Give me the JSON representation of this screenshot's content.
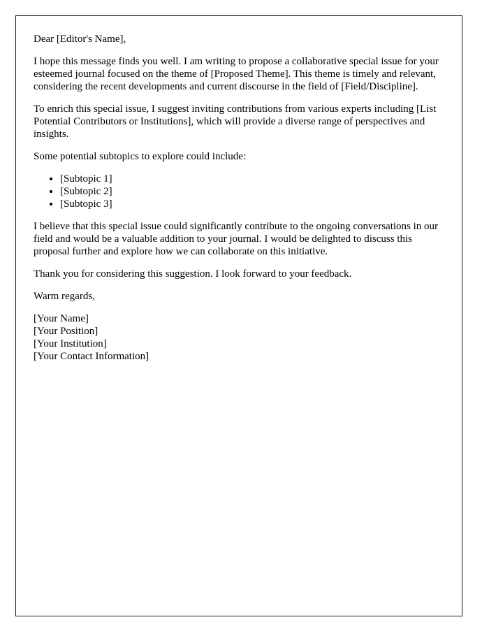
{
  "document": {
    "type": "letter",
    "salutation": "Dear [Editor's Name],",
    "paragraphs": {
      "intro": "I hope this message finds you well. I am writing to propose a collaborative special issue for your esteemed journal focused on the theme of [Proposed Theme]. This theme is timely and relevant, considering the recent developments and current discourse in the field of [Field/Discipline].",
      "contributors": "To enrich this special issue, I suggest inviting contributions from various experts including [List Potential Contributors or Institutions], which will provide a diverse range of perspectives and insights.",
      "list_intro": "Some potential subtopics to explore could include:",
      "belief": "I believe that this special issue could significantly contribute to the ongoing conversations in our field and would be a valuable addition to your journal. I would be delighted to discuss this proposal further and explore how we can collaborate on this initiative.",
      "thanks": "Thank you for considering this suggestion. I look forward to your feedback."
    },
    "subtopics": [
      "[Subtopic 1]",
      "[Subtopic 2]",
      "[Subtopic 3]"
    ],
    "closing": "Warm regards,",
    "signature": [
      "[Your Name]",
      "[Your Position]",
      "[Your Institution]",
      "[Your Contact Information]"
    ]
  },
  "style": {
    "page_background": "#ffffff",
    "border_color": "#1a1a1a",
    "text_color": "#000000"
  }
}
